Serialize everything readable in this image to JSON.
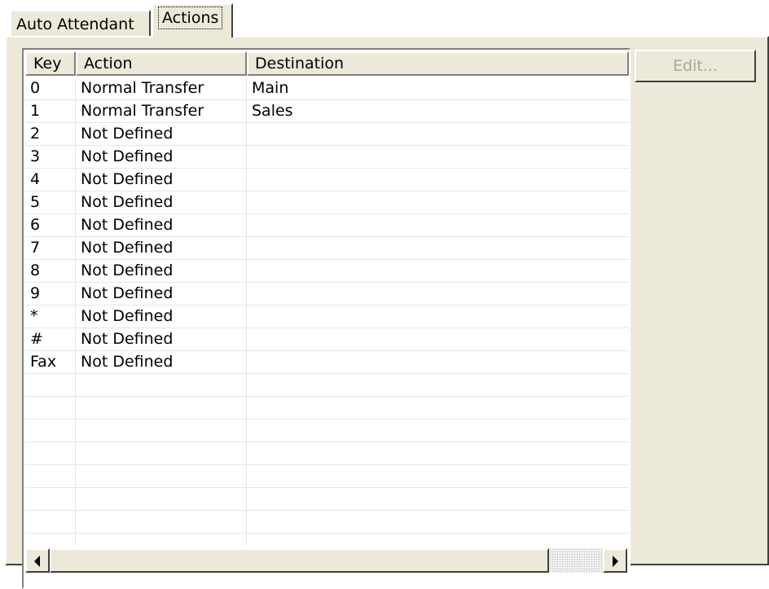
{
  "tabs": [
    {
      "label": "Auto Attendant",
      "active": false
    },
    {
      "label": "Actions",
      "active": true
    }
  ],
  "edit_button": {
    "label": "Edit...",
    "enabled": false
  },
  "table": {
    "columns": [
      "Key",
      "Action",
      "Destination"
    ],
    "rows": [
      {
        "key": "0",
        "action": "Normal Transfer",
        "destination": "Main"
      },
      {
        "key": "1",
        "action": "Normal Transfer",
        "destination": "Sales"
      },
      {
        "key": "2",
        "action": "Not Defined",
        "destination": ""
      },
      {
        "key": "3",
        "action": "Not Defined",
        "destination": ""
      },
      {
        "key": "4",
        "action": "Not Defined",
        "destination": ""
      },
      {
        "key": "5",
        "action": "Not Defined",
        "destination": ""
      },
      {
        "key": "6",
        "action": "Not Defined",
        "destination": ""
      },
      {
        "key": "7",
        "action": "Not Defined",
        "destination": ""
      },
      {
        "key": "8",
        "action": "Not Defined",
        "destination": ""
      },
      {
        "key": "9",
        "action": "Not Defined",
        "destination": ""
      },
      {
        "key": "*",
        "action": "Not Defined",
        "destination": ""
      },
      {
        "key": "#",
        "action": "Not Defined",
        "destination": ""
      },
      {
        "key": "Fax",
        "action": "Not Defined",
        "destination": ""
      }
    ]
  },
  "icons": {
    "scroll_left": "arrow-left-icon",
    "scroll_right": "arrow-right-icon"
  },
  "colors": {
    "face": "#ece9d8",
    "disabled_text": "#aca899",
    "grid": "#e6e6e6"
  }
}
